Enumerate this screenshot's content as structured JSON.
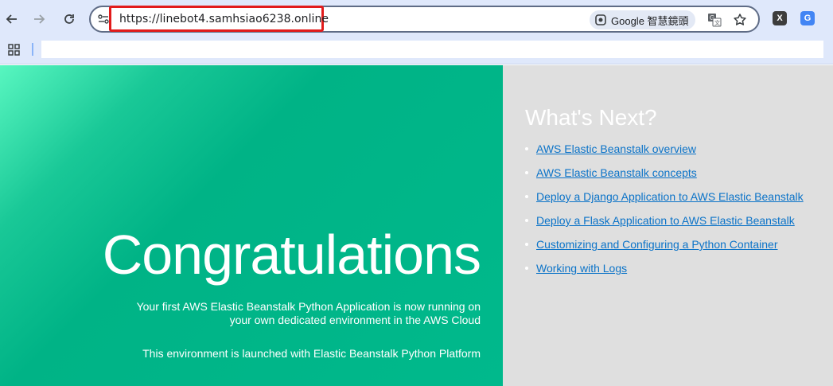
{
  "browser": {
    "url": "https://linebot4.samhsiao6238.online",
    "lens_label": "Google 智慧鏡頭",
    "extensions": [
      {
        "name": "x-extension-icon",
        "label": "X",
        "color": "#3c3c3c"
      },
      {
        "name": "google-translate-extension-icon",
        "label": "G",
        "color": "#4285f4"
      }
    ],
    "highlight_color": "#e21b1b"
  },
  "hero": {
    "title": "Congratulations",
    "text": "Your first AWS Elastic Beanstalk Python Application is now running on your own dedicated environment in the AWS Cloud",
    "text2": "This environment is launched with Elastic Beanstalk Python Platform",
    "gradient_colors": [
      "#58f6c0",
      "#00b386"
    ]
  },
  "sidebar": {
    "title": "What's Next?",
    "links": [
      "AWS Elastic Beanstalk overview",
      "AWS Elastic Beanstalk concepts",
      "Deploy a Django Application to AWS Elastic Beanstalk",
      "Deploy a Flask Application to AWS Elastic Beanstalk",
      "Customizing and Configuring a Python Container",
      "Working with Logs"
    ],
    "link_color": "#0b73c8",
    "background": "#dfdfdf"
  }
}
